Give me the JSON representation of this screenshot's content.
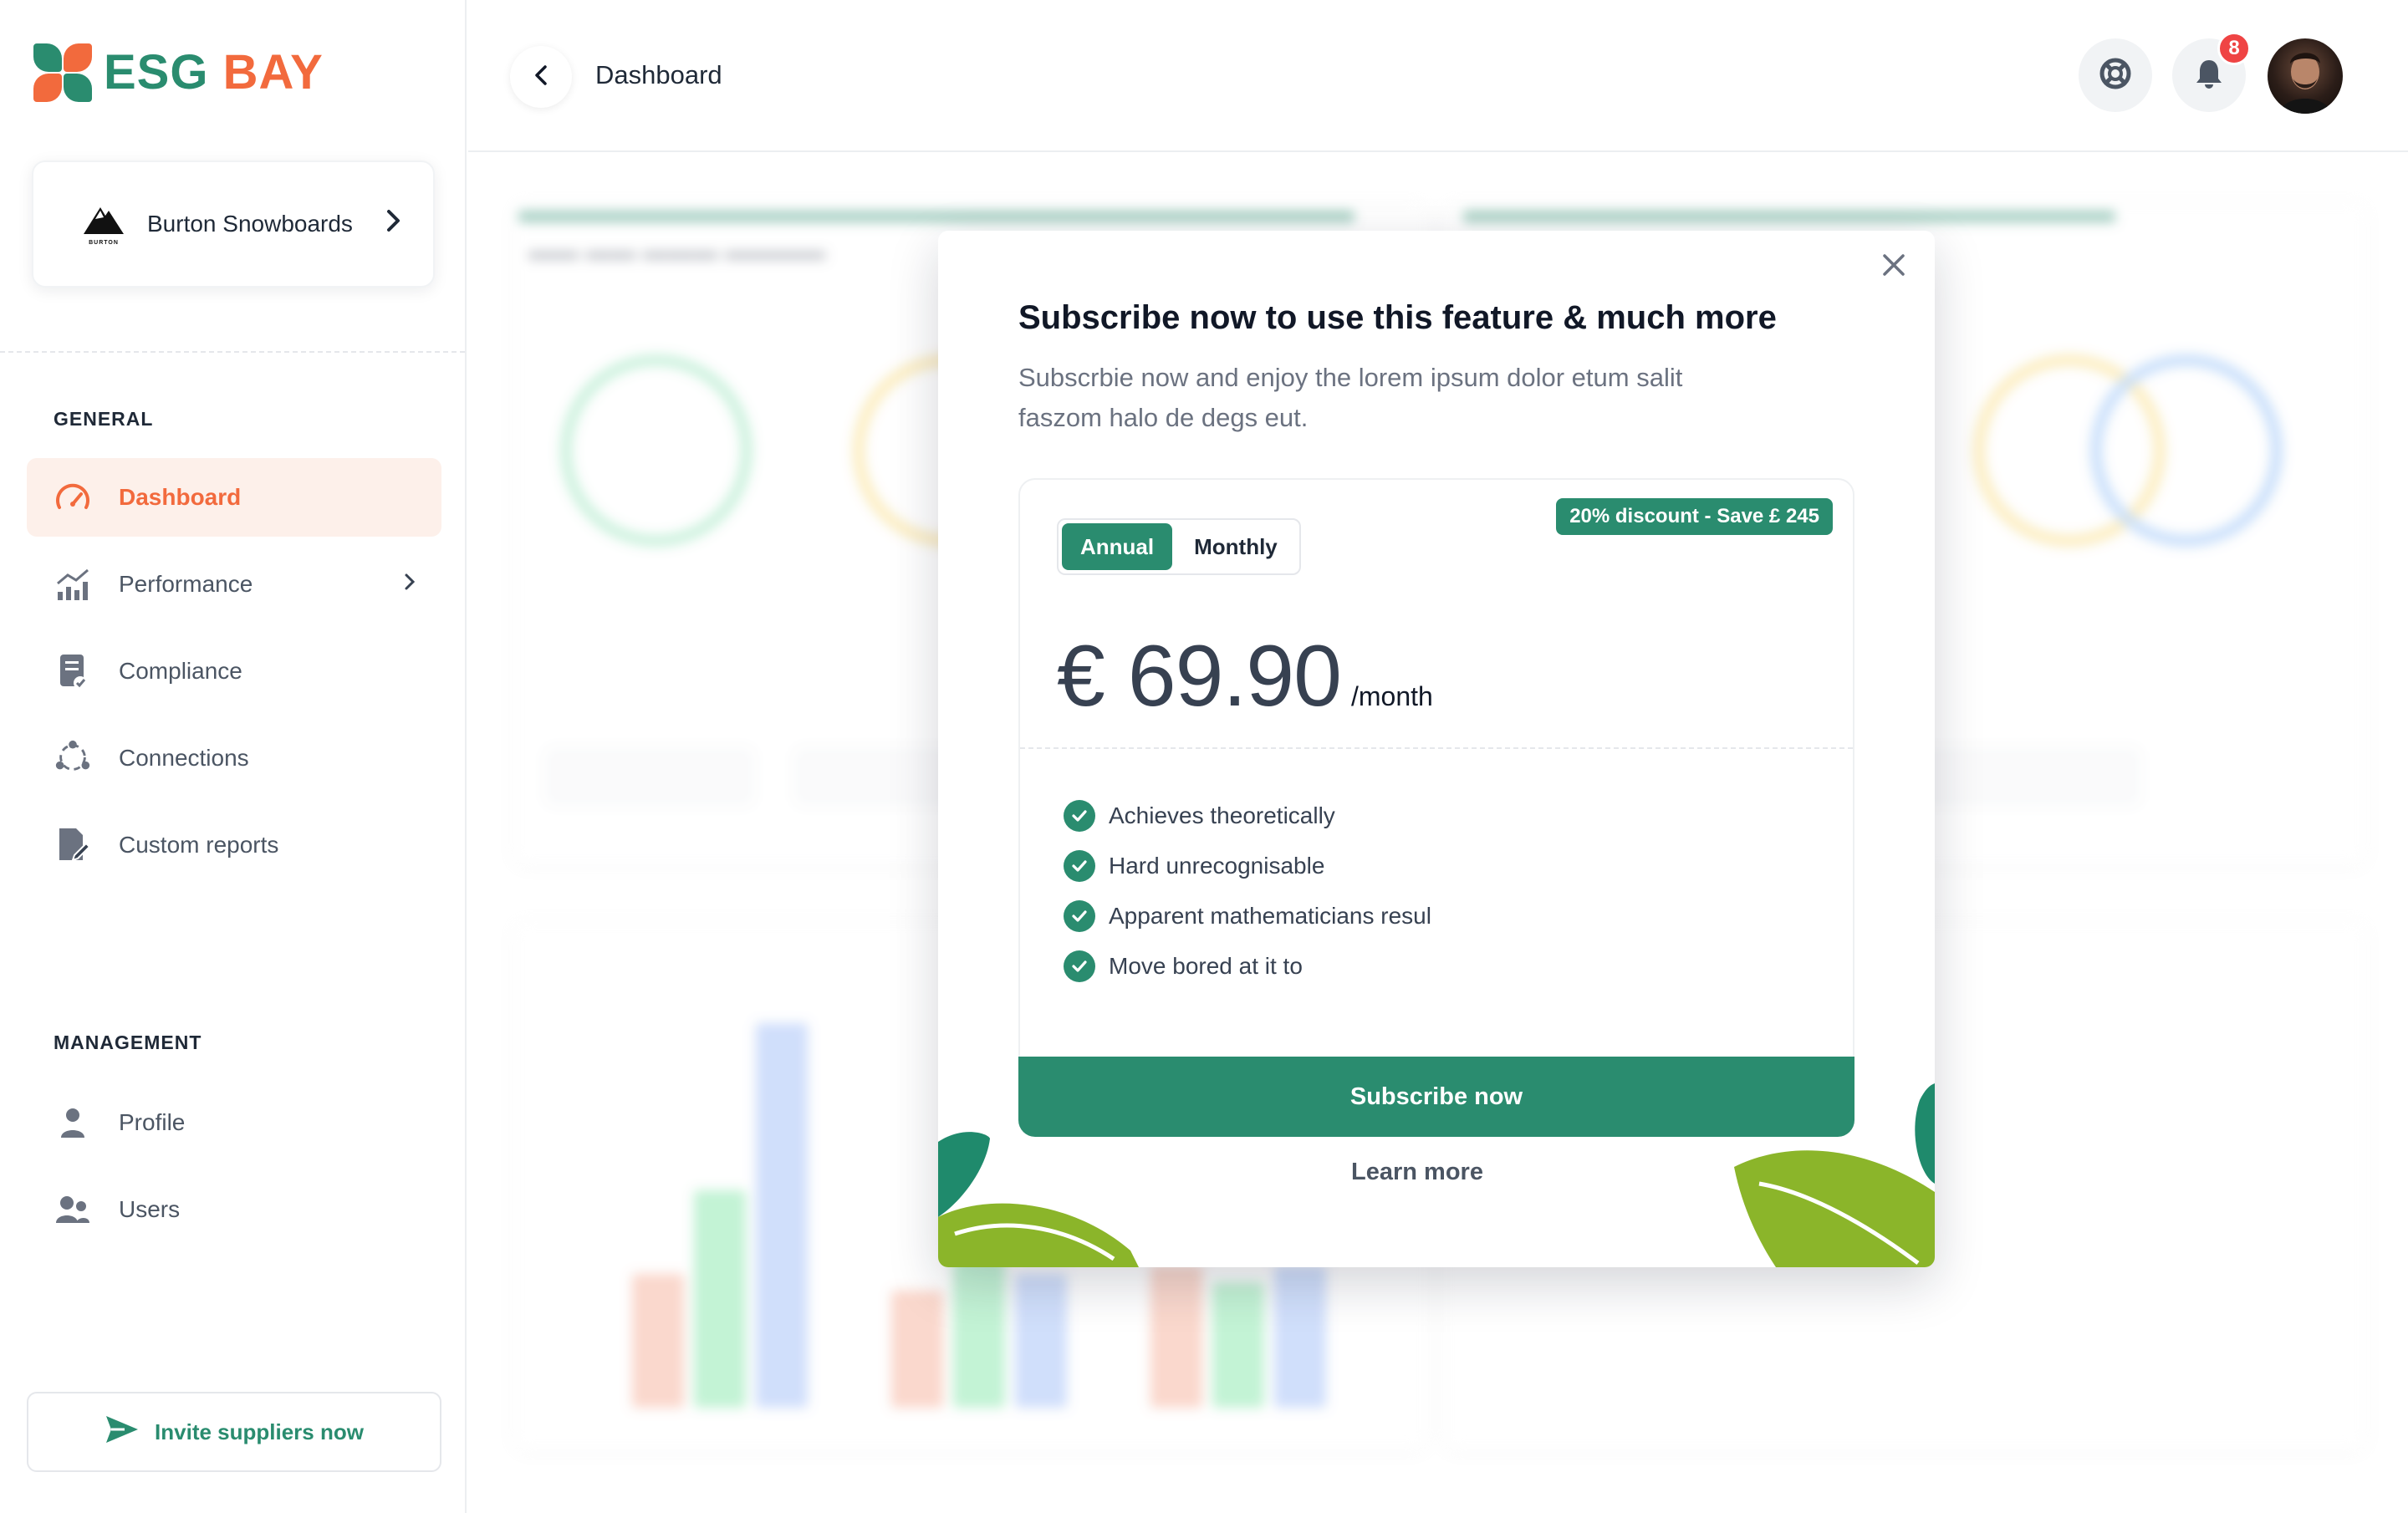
{
  "brand": {
    "name_part1": "ESG",
    "name_part2": "BAY",
    "colors": {
      "green": "#2a8c6f",
      "orange": "#f26a3d"
    }
  },
  "company": {
    "name": "Burton Snowboards",
    "logo_text": "BURTON"
  },
  "sidebar": {
    "general_title": "GENERAL",
    "general_items": [
      {
        "label": "Dashboard",
        "icon": "speedometer-icon",
        "active": true
      },
      {
        "label": "Performance",
        "icon": "bar-chart-icon"
      },
      {
        "label": "Compliance",
        "icon": "document-check-icon"
      },
      {
        "label": "Connections",
        "icon": "connections-icon"
      },
      {
        "label": "Custom reports",
        "icon": "report-edit-icon"
      }
    ],
    "management_title": "MANAGEMENT",
    "management_items": [
      {
        "label": "Profile",
        "icon": "user-icon"
      },
      {
        "label": "Users",
        "icon": "users-icon"
      }
    ],
    "invite_label": "Invite suppliers now"
  },
  "header": {
    "title": "Dashboard",
    "notification_count": "8"
  },
  "modal": {
    "title": "Subscribe now to use this feature & much more",
    "subtitle": "Subscrbie now and enjoy the lorem ipsum dolor etum salit faszom halo de degs eut.",
    "toggle": {
      "annual": "Annual",
      "monthly": "Monthly",
      "selected": "Annual"
    },
    "discount": "20% discount - Save £ 245",
    "price": "€ 69.90",
    "period": "/month",
    "features": [
      "Achieves theoretically",
      "Hard unrecognisable",
      "Apparent mathematicians resul",
      "Move bored at it to"
    ],
    "subscribe_label": "Subscribe now",
    "learn_more_label": "Learn more"
  }
}
